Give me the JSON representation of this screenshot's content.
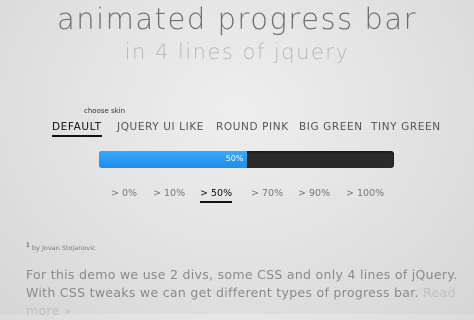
{
  "header": {
    "title": "animated progress bar",
    "subtitle": "in 4 lines of jquery"
  },
  "skins": {
    "label": "choose skin",
    "items": [
      {
        "label": "DEFAULT",
        "active": true
      },
      {
        "label": "JQUERY UI LIKE",
        "active": false
      },
      {
        "label": "ROUND PINK",
        "active": false
      },
      {
        "label": "BIG GREEN",
        "active": false
      },
      {
        "label": "TINY GREEN",
        "active": false
      }
    ]
  },
  "progress": {
    "value_label": "50%",
    "fraction": 0.5,
    "fill_color": "#2196f3",
    "track_color": "#2a2a2a"
  },
  "percent_options": [
    {
      "label": "> 0%",
      "active": false
    },
    {
      "label": "> 10%",
      "active": false
    },
    {
      "label": "> 50%",
      "active": true
    },
    {
      "label": "> 70%",
      "active": false
    },
    {
      "label": "> 90%",
      "active": false
    },
    {
      "label": "> 100%",
      "active": false
    }
  ],
  "footnote": {
    "marker": "1",
    "text": "by Jovan Stojanovic"
  },
  "description": {
    "text": "For this demo we use 2 divs, some CSS and only 4 lines of jQuery. With CSS tweaks we can get different types of progress bar.",
    "link_text": "Read more »"
  }
}
